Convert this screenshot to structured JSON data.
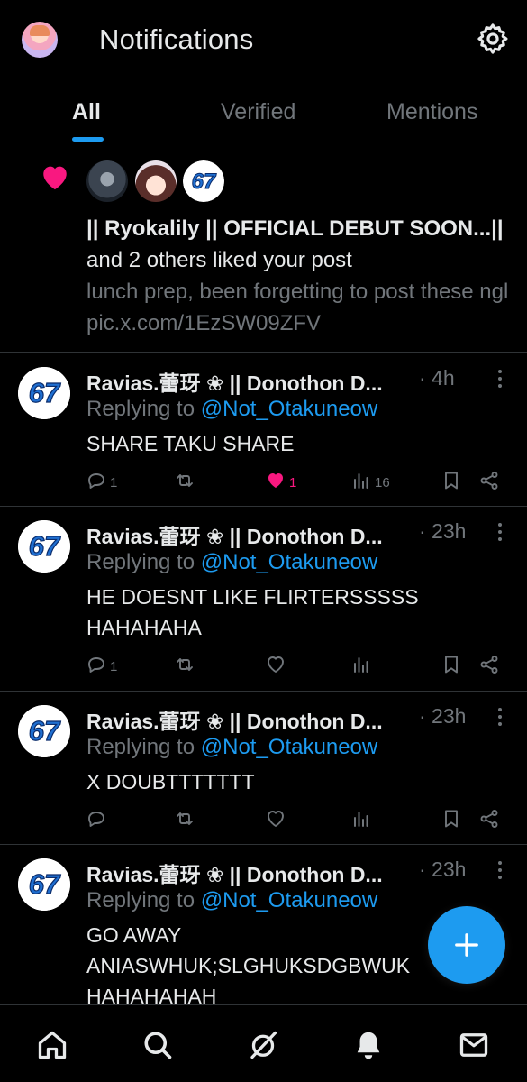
{
  "header": {
    "title": "Notifications",
    "avatar": "profile-avatar",
    "settings_icon": "gear-icon"
  },
  "tabs": [
    {
      "label": "All",
      "active": true
    },
    {
      "label": "Verified",
      "active": false
    },
    {
      "label": "Mentions",
      "active": false
    }
  ],
  "like_notification": {
    "icon": "heart-icon",
    "actor_bold": "|| Ryokalily || OFFICIAL DEBUT SOON...||",
    "action_text": " and 2 others liked your post",
    "post_preview": "lunch prep, been forgetting to post these ngl pic.x.com/1EzSW09ZFV"
  },
  "replies": [
    {
      "name": "Ravias.蕾玡 ❀ || Donothon D...",
      "time": "· 4h",
      "replying_prefix": "Replying to ",
      "handle": "@Not_Otakuneow",
      "body": "SHARE TAKU SHARE",
      "reply_count": "1",
      "repost_count": "",
      "like_count": "1",
      "liked": true,
      "view_count": "16"
    },
    {
      "name": "Ravias.蕾玡 ❀ || Donothon D...",
      "time": "· 23h",
      "replying_prefix": "Replying to ",
      "handle": "@Not_Otakuneow",
      "body": "HE DOESNT LIKE FLIRTERSSSSS HAHAHAHA",
      "reply_count": "1",
      "repost_count": "",
      "like_count": "",
      "liked": false,
      "view_count": ""
    },
    {
      "name": "Ravias.蕾玡 ❀ || Donothon D...",
      "time": "· 23h",
      "replying_prefix": "Replying to ",
      "handle": "@Not_Otakuneow",
      "body": "X DOUBTTTTTTT",
      "reply_count": "",
      "repost_count": "",
      "like_count": "",
      "liked": false,
      "view_count": ""
    },
    {
      "name": "Ravias.蕾玡 ❀ || Donothon D...",
      "time": "· 23h",
      "replying_prefix": "Replying to ",
      "handle": "@Not_Otakuneow",
      "body": "GO AWAY ANIASWHUK;SLGHUKSDGBWUK HAHAHAHAH"
    }
  ],
  "badge_text": "67",
  "colors": {
    "background": "#000000",
    "accent": "#1d9bf0",
    "like": "#f91880",
    "muted": "#71767b",
    "text": "#e7e9ea",
    "divider": "#2f3336"
  },
  "fab_icon": "plus-icon",
  "bottom_nav": [
    "home-icon",
    "search-icon",
    "grok-icon",
    "bell-icon",
    "mail-icon"
  ]
}
